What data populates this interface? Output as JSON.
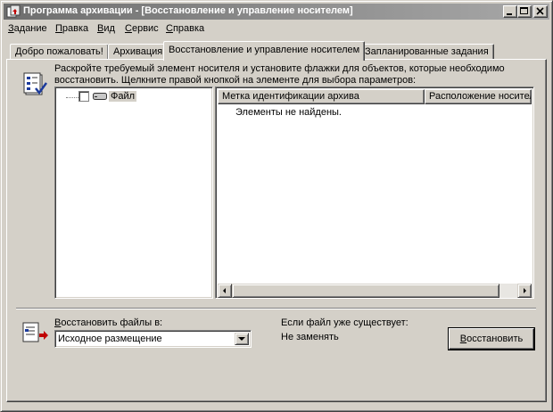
{
  "window": {
    "title": "Программа архивации - [Восстановление и управление носителем]"
  },
  "menu": [
    {
      "label": "Задание",
      "accel": "З",
      "rest": "адание"
    },
    {
      "label": "Правка",
      "accel": "П",
      "rest": "равка"
    },
    {
      "label": "Вид",
      "accel": "В",
      "rest": "ид"
    },
    {
      "label": "Сервис",
      "accel": "С",
      "rest": "ервис"
    },
    {
      "label": "Справка",
      "accel": "С",
      "rest": "правка"
    }
  ],
  "tabs": [
    {
      "label": "Добро пожаловать!"
    },
    {
      "label": "Архивация"
    },
    {
      "label": "Восстановление и управление носителем",
      "active": true
    },
    {
      "label": "Запланированные задания"
    }
  ],
  "instructions": "Раскройте требуемый элемент носителя и установите флажки для объектов, которые необходимо восстановить. Щелкните правой кнопкой на элементе для выбора параметров:",
  "tree": {
    "items": [
      {
        "label": "Файл",
        "checked": false
      }
    ]
  },
  "list": {
    "columns": [
      "Метка идентификации архива",
      "Расположение носител"
    ],
    "empty_message": "Элементы не найдены."
  },
  "restore": {
    "label_accel": "В",
    "label_rest": "осстановить файлы в:",
    "selected": "Исходное размещение",
    "exists_label": "Если файл уже существует:",
    "exists_value": "Не заменять",
    "button_accel": "В",
    "button_rest": "осстановить"
  },
  "icons": {
    "app": "backup-app-icon",
    "instructions": "checklist-icon",
    "restore": "restore-document-icon",
    "tree_item": "drive-icon"
  }
}
